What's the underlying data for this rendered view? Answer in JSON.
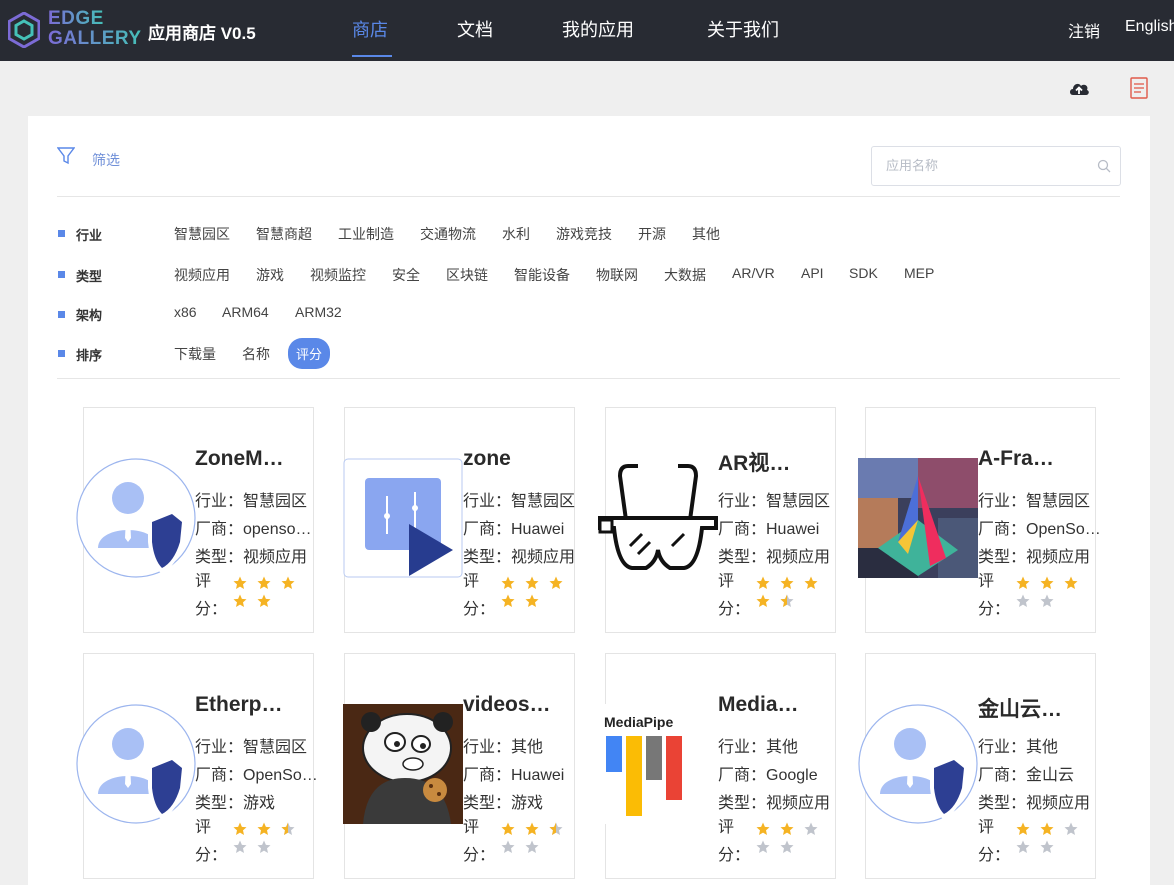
{
  "header": {
    "logo_line1": "EDGE",
    "logo_line2": "GALLERY",
    "app_title": "应用商店 V0.5",
    "nav": [
      {
        "label": "商店",
        "active": true
      },
      {
        "label": "文档",
        "active": false
      },
      {
        "label": "我的应用",
        "active": false
      },
      {
        "label": "关于我们",
        "active": false
      }
    ],
    "logout": "注销",
    "language": "English"
  },
  "toolbar": {
    "icons": [
      "upload-cloud-icon",
      "document-icon"
    ]
  },
  "filter": {
    "label": "筛选",
    "search_placeholder": "应用名称",
    "rows": [
      {
        "label": "行业",
        "options": [
          "智慧园区",
          "智慧商超",
          "工业制造",
          "交通物流",
          "水利",
          "游戏竞技",
          "开源",
          "其他"
        ]
      },
      {
        "label": "类型",
        "options": [
          "视频应用",
          "游戏",
          "视频监控",
          "安全",
          "区块链",
          "智能设备",
          "物联网",
          "大数据",
          "AR/VR",
          "API",
          "SDK",
          "MEP"
        ]
      },
      {
        "label": "架构",
        "options": [
          "x86",
          "ARM64",
          "ARM32"
        ]
      },
      {
        "label": "排序",
        "options": [
          "下载量",
          "名称",
          "评分"
        ],
        "selected": "评分"
      }
    ]
  },
  "apps": [
    {
      "title": "ZoneM…",
      "industry": "行业：智慧园区",
      "vendor": "厂商：opensou…",
      "type": "类型：视频应用",
      "rating_label": "评分：",
      "rating": 5,
      "image": "default-avatar"
    },
    {
      "title": "zone",
      "industry": "行业：智慧园区",
      "vendor": "厂商：Huawei",
      "type": "类型：视频应用",
      "rating_label": "评分：",
      "rating": 5,
      "image": "video-play-icon"
    },
    {
      "title": "AR视…",
      "industry": "行业：智慧园区",
      "vendor": "厂商：Huawei",
      "type": "类型：视频应用",
      "rating_label": "评分：",
      "rating": 4.5,
      "image": "ar-glasses-icon"
    },
    {
      "title": "A-Fra…",
      "industry": "行业：智慧园区",
      "vendor": "厂商：OpenSo…",
      "type": "类型：视频应用",
      "rating_label": "评分：",
      "rating": 3,
      "image": "aframe-logo"
    },
    {
      "title": "Etherp…",
      "industry": "行业：智慧园区",
      "vendor": "厂商：OpenSo…",
      "type": "类型：游戏",
      "rating_label": "评分：",
      "rating": 2.5,
      "image": "default-avatar"
    },
    {
      "title": "videos…",
      "industry": "行业：其他",
      "vendor": "厂商：Huawei",
      "type": "类型：游戏",
      "rating_label": "评分：",
      "rating": 2.5,
      "image": "panda-bear-image"
    },
    {
      "title": "Media…",
      "industry": "行业：其他",
      "vendor": "厂商：Google",
      "type": "类型：视频应用",
      "rating_label": "评分：",
      "rating": 2,
      "image": "mediapipe-logo",
      "image_text": "MediaPipe"
    },
    {
      "title": "金山云…",
      "industry": "行业：其他",
      "vendor": "厂商：金山云",
      "type": "类型：视频应用",
      "rating_label": "评分：",
      "rating": 2,
      "image": "default-avatar"
    }
  ],
  "colors": {
    "topbar": "#282b33",
    "accent": "#5a88e8",
    "star_on": "#f5b323",
    "star_off": "#c0c4cc"
  }
}
